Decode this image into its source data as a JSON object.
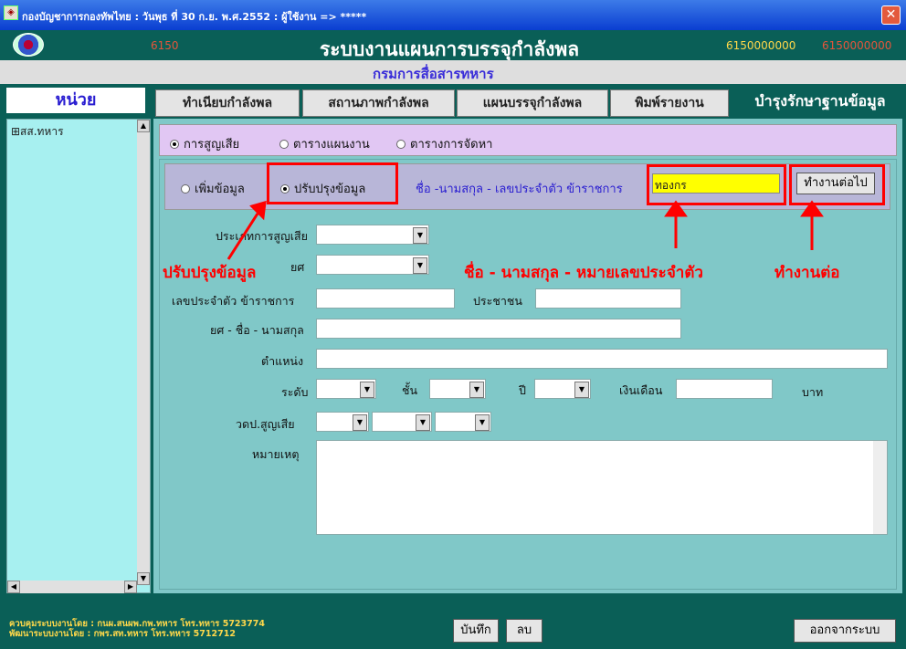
{
  "window": {
    "title": "กองบัญชาการกองทัพไทย : วันพุธ    ที่ 30 ก.ย.  พ.ศ.2552 : ผู้ใช้งาน => *****",
    "close": "✕"
  },
  "header": {
    "code_left": "6150",
    "app_title": "ระบบงานแผนการบรรจุกำลังพล",
    "code_right1": "6150000000",
    "code_right2": "6150000000",
    "department": "กรมการสื่อสารทหาร"
  },
  "sidebar": {
    "label": "หน่วย",
    "tree_item": "⊞สส.ทหาร"
  },
  "tabs": [
    "ทำเนียบกำลังพล",
    "สถานภาพกำลังพล",
    "แผนบรรจุกำลังพล",
    "พิมพ์รายงาน",
    "บำรุงรักษาฐานข้อมูล"
  ],
  "report_types": [
    {
      "label": "การสูญเสีย",
      "selected": true
    },
    {
      "label": "ตารางแผนงาน",
      "selected": false
    },
    {
      "label": "ตารางการจัดหา",
      "selected": false
    }
  ],
  "actions": {
    "add_label": "เพิ่มข้อมูล",
    "update_label": "ปรับปรุงข้อมูล",
    "update_selected": true,
    "name_prompt": "ชื่อ -นามสกุล - เลขประจำตัว ข้าราชการ",
    "name_value": "ทองกร",
    "continue": "ทำงานต่อไป"
  },
  "form": {
    "loss_type": "ประเภทการสูญเสีย",
    "rank": "ยศ",
    "id_no": "เลขประจำตัว ข้าราชการ",
    "citizen": "ประชาชน",
    "rank_name": "ยศ - ชื่อ - นามสกุล",
    "position": "ตำแหน่ง",
    "level": "ระดับ",
    "step": "ชั้น",
    "year": "ปี",
    "salary": "เงินเดือน",
    "baht": "บาท",
    "loss_date": "วดป.สูญเสีย",
    "remark": "หมายเหตุ"
  },
  "annotations": {
    "update": "ปรับปรุงข้อมูล",
    "name": "ชื่อ - นามสกุล - หมายเลขประจำตัว",
    "continue": "ทำงานต่อ"
  },
  "footer": {
    "controlled_by": "ควบคุมระบบงานโดย : กนผ.สนผพ.กพ.ทหาร  โทร.ทหาร  5723774",
    "developed_by": "พัฒนาระบบงานโดย : กพร.สท.ทหาร         โทร.ทหาร  5712712",
    "save": "บันทึก",
    "delete": "ลบ",
    "logout": "ออกจากระบบ"
  }
}
